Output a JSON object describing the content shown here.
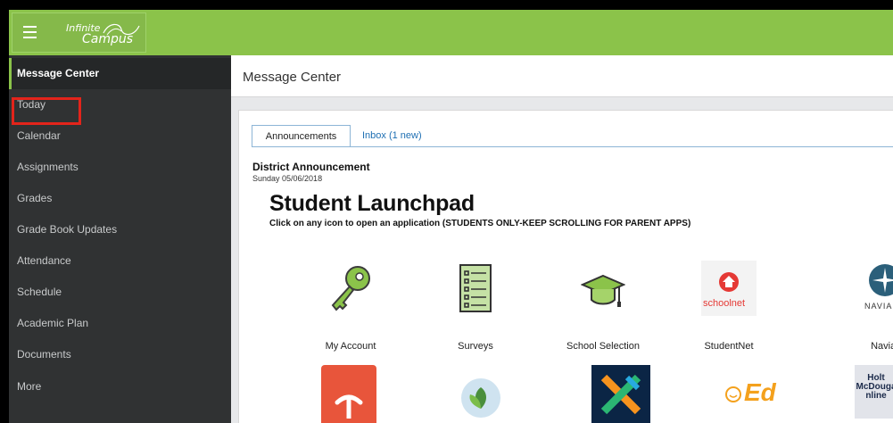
{
  "brand": {
    "line1": "Infinite",
    "line2": "Campus"
  },
  "sidebar": {
    "items": [
      {
        "label": "Message Center"
      },
      {
        "label": "Today"
      },
      {
        "label": "Calendar"
      },
      {
        "label": "Assignments"
      },
      {
        "label": "Grades"
      },
      {
        "label": "Grade Book Updates"
      },
      {
        "label": "Attendance"
      },
      {
        "label": "Schedule"
      },
      {
        "label": "Academic Plan"
      },
      {
        "label": "Documents"
      },
      {
        "label": "More"
      }
    ]
  },
  "main": {
    "title": "Message Center",
    "tabs": [
      {
        "label": "Announcements"
      },
      {
        "label": "Inbox (1 new)"
      }
    ],
    "announcement": {
      "title": "District Announcement",
      "date": "Sunday 05/06/2018"
    },
    "launchpad": {
      "title": "Student Launchpad",
      "subtitle": "Click on any icon to open an application (STUDENTS ONLY-KEEP SCROLLING FOR PARENT APPS)",
      "apps": [
        {
          "label": "My Account",
          "icon": "key-icon"
        },
        {
          "label": "Surveys",
          "icon": "survey-checklist-icon"
        },
        {
          "label": "School Selection",
          "icon": "graduation-cap-icon"
        },
        {
          "label": "StudentNet",
          "icon": "schoolnet-logo"
        },
        {
          "label": "Naviance",
          "icon": "naviance-logo"
        }
      ],
      "icon_text": {
        "schoolnet": "schoolnet",
        "naviance": "NAVIANC",
        "ed": "Ed",
        "holt1": "Holt",
        "holt2": "McDouga",
        "holt3": "nline"
      }
    }
  },
  "colors": {
    "topbar": "#8bc34a",
    "sidebar": "#303233",
    "highlight_box": "#e3241b",
    "link": "#1e6fb3"
  }
}
